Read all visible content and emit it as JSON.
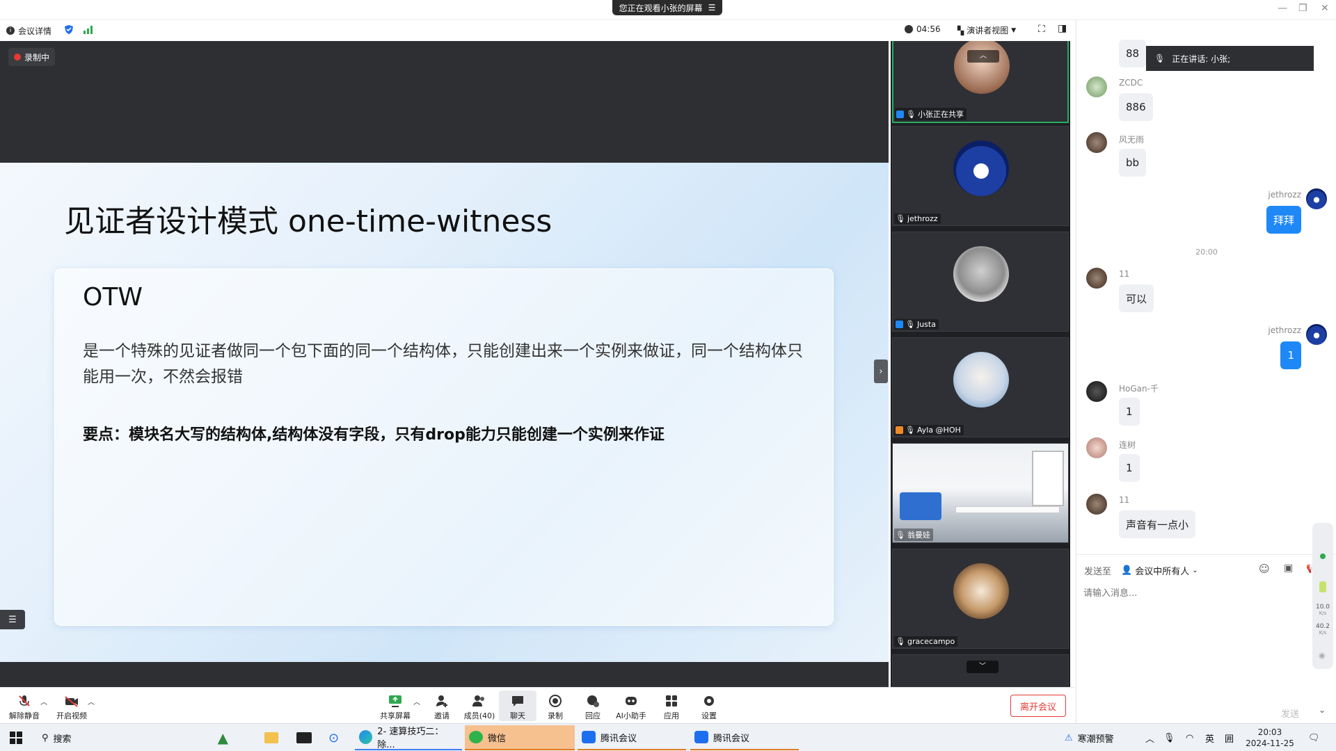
{
  "banner": {
    "viewing": "您正在观看小张的屏幕"
  },
  "toolbar": {
    "meeting_info": "会议详情",
    "timer": "04:56",
    "view_mode": "演讲者视图",
    "chat_title": "聊天"
  },
  "recording": {
    "label": "录制中"
  },
  "slide": {
    "title": "见证者设计模式 one-time-witness",
    "heading": "OTW",
    "body": "是一个特殊的见证者做同一个包下面的同一个结构体，只能创建出来一个实例来做证，同一个结构体只能用一次，不然会报错",
    "key_point": "要点：模块名大写的结构体,结构体没有字段，只有drop能力只能创建一个实例来作证"
  },
  "participants": [
    {
      "name": "小张正在共享",
      "status_color": "#27ae60"
    },
    {
      "name": "jethrozz"
    },
    {
      "name": "Justa"
    },
    {
      "name": "Ayla @HOH"
    },
    {
      "name": "翁曼娃"
    },
    {
      "name": "gracecampo"
    }
  ],
  "speaking": {
    "label": "正在讲话: 小张;"
  },
  "chat": {
    "time_divider": "20:00",
    "messages": [
      {
        "sender": "",
        "text": "88",
        "mine": false
      },
      {
        "sender": "ZCDC",
        "text": "886",
        "mine": false
      },
      {
        "sender": "风无雨",
        "text": "bb",
        "mine": false
      },
      {
        "sender": "jethrozz",
        "text": "拜拜",
        "mine": true
      },
      {
        "sender": "11",
        "text": "可以",
        "mine": false
      },
      {
        "sender": "jethrozz",
        "text": "1",
        "mine": true
      },
      {
        "sender": "HoGan-千",
        "text": "1",
        "mine": false
      },
      {
        "sender": "连树",
        "text": "1",
        "mine": false
      },
      {
        "sender": "11",
        "text": "声音有一点小",
        "mine": false
      }
    ],
    "send_to_label": "发送至",
    "send_to_target": "会议中所有人",
    "input_placeholder": "请输入消息...",
    "send_button": "发送"
  },
  "side_meter": {
    "up": "10.0",
    "down": "40.2",
    "unit": "K/s"
  },
  "controls": {
    "mute": "解除静音",
    "video": "开启视频",
    "share": "共享屏幕",
    "invite": "邀请",
    "members": "成员(40)",
    "chat": "聊天",
    "record": "录制",
    "reply": "回应",
    "ai": "AI小助手",
    "apps": "应用",
    "settings": "设置",
    "leave": "离开会议"
  },
  "taskbar": {
    "search": "搜索",
    "edge_tab": "2- 速算技巧二：除...",
    "wechat": "微信",
    "meeting1": "腾讯会议",
    "meeting2": "腾讯会议",
    "weather": "寒潮预警",
    "ime": "英",
    "ime2": "囲",
    "clock_time": "20:03",
    "clock_date": "2024-11-25"
  }
}
